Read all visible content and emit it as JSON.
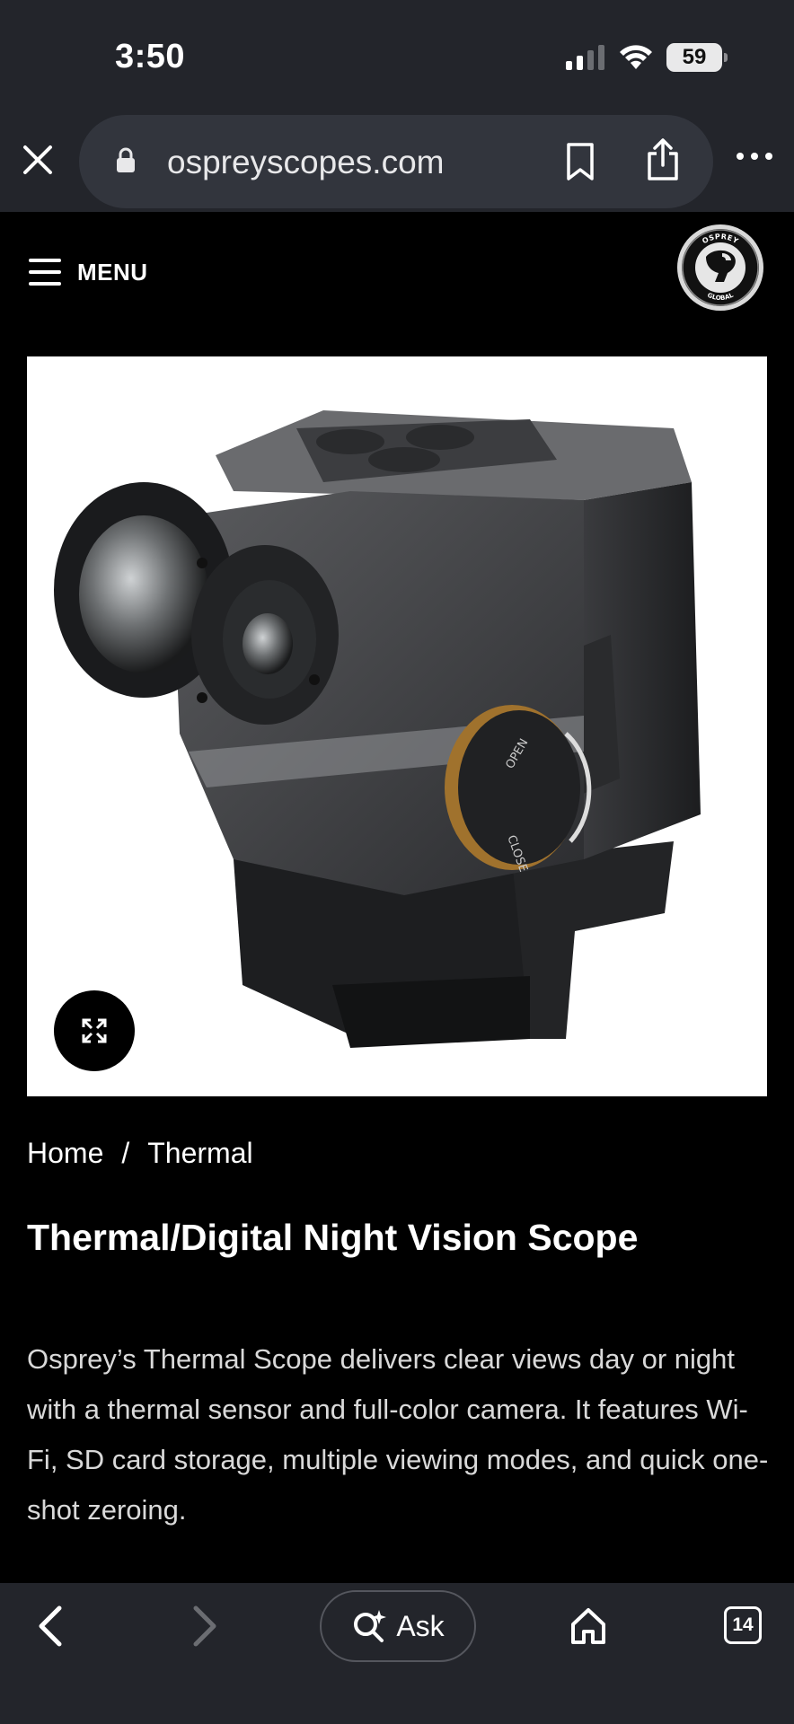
{
  "status": {
    "time": "3:50",
    "battery": "59"
  },
  "browser": {
    "url": "ospreyscopes.com"
  },
  "site": {
    "menu_label": "MENU",
    "logo_top": "OSPREY",
    "logo_bottom": "GLOBAL"
  },
  "product_image": {
    "dial_open": "OPEN",
    "dial_close": "CLOSE"
  },
  "breadcrumb": {
    "home": "Home",
    "separator": "/",
    "current": "Thermal"
  },
  "product": {
    "title": "Thermal/Digital Night Vision Scope",
    "description": "Osprey’s Thermal Scope delivers clear views day or night with a thermal sensor and full-color camera. It features Wi-Fi, SD card storage, multiple viewing modes, and quick one-shot zeroing."
  },
  "toolbar": {
    "ask_label": "Ask",
    "tab_count": "14"
  },
  "colors": {
    "chrome_bg": "#23252b",
    "page_bg": "#000000",
    "urlbar_bg": "#32353d"
  },
  "icons": [
    "close-icon",
    "lock-icon",
    "bookmark-icon",
    "share-icon",
    "more-icon",
    "hamburger-icon",
    "expand-icon",
    "back-icon",
    "forward-icon",
    "ask-search-icon",
    "home-icon",
    "tabs-icon"
  ]
}
